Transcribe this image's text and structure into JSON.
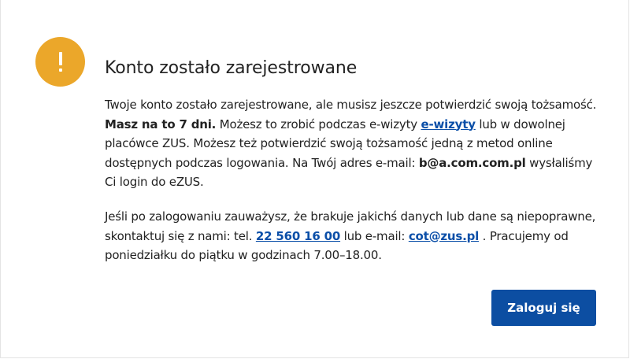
{
  "dialog": {
    "icon": "exclamation-icon",
    "icon_color": "#eba72a",
    "title": "Konto zostało zarejestrowane",
    "paragraph1": {
      "t1": "Twoje konto zostało zarejestrowane, ale musisz jeszcze potwierdzić swoją tożsamość. ",
      "bold1": "Masz na to 7 dni.",
      "t2": " Możesz to zrobić podczas e-wizyty ",
      "link_ewizyty": "e-wizyty",
      "t3": " lub w dowolnej placówce ZUS. Możesz też potwierdzić swoją tożsamość jedną z metod online dostępnych podczas logowania. Na Twój adres e-mail: ",
      "email": "b@a.com.com.pl",
      "t4": " wysłaliśmy Ci login do eZUS."
    },
    "paragraph2": {
      "t1": "Jeśli po zalogowaniu zauważysz, że brakuje jakichś danych lub dane są niepoprawne, skontaktuj się z nami: tel. ",
      "phone_link": "22 560 16 00",
      "t2": " lub e-mail: ",
      "email_link": "cot@zus.pl",
      "t3": " . Pracujemy od poniedziałku do piątku w godzinach 7.00–18.00."
    },
    "login_button_label": "Zaloguj się",
    "accent_color": "#0c4ea2",
    "link_color": "#0b4fa8"
  }
}
